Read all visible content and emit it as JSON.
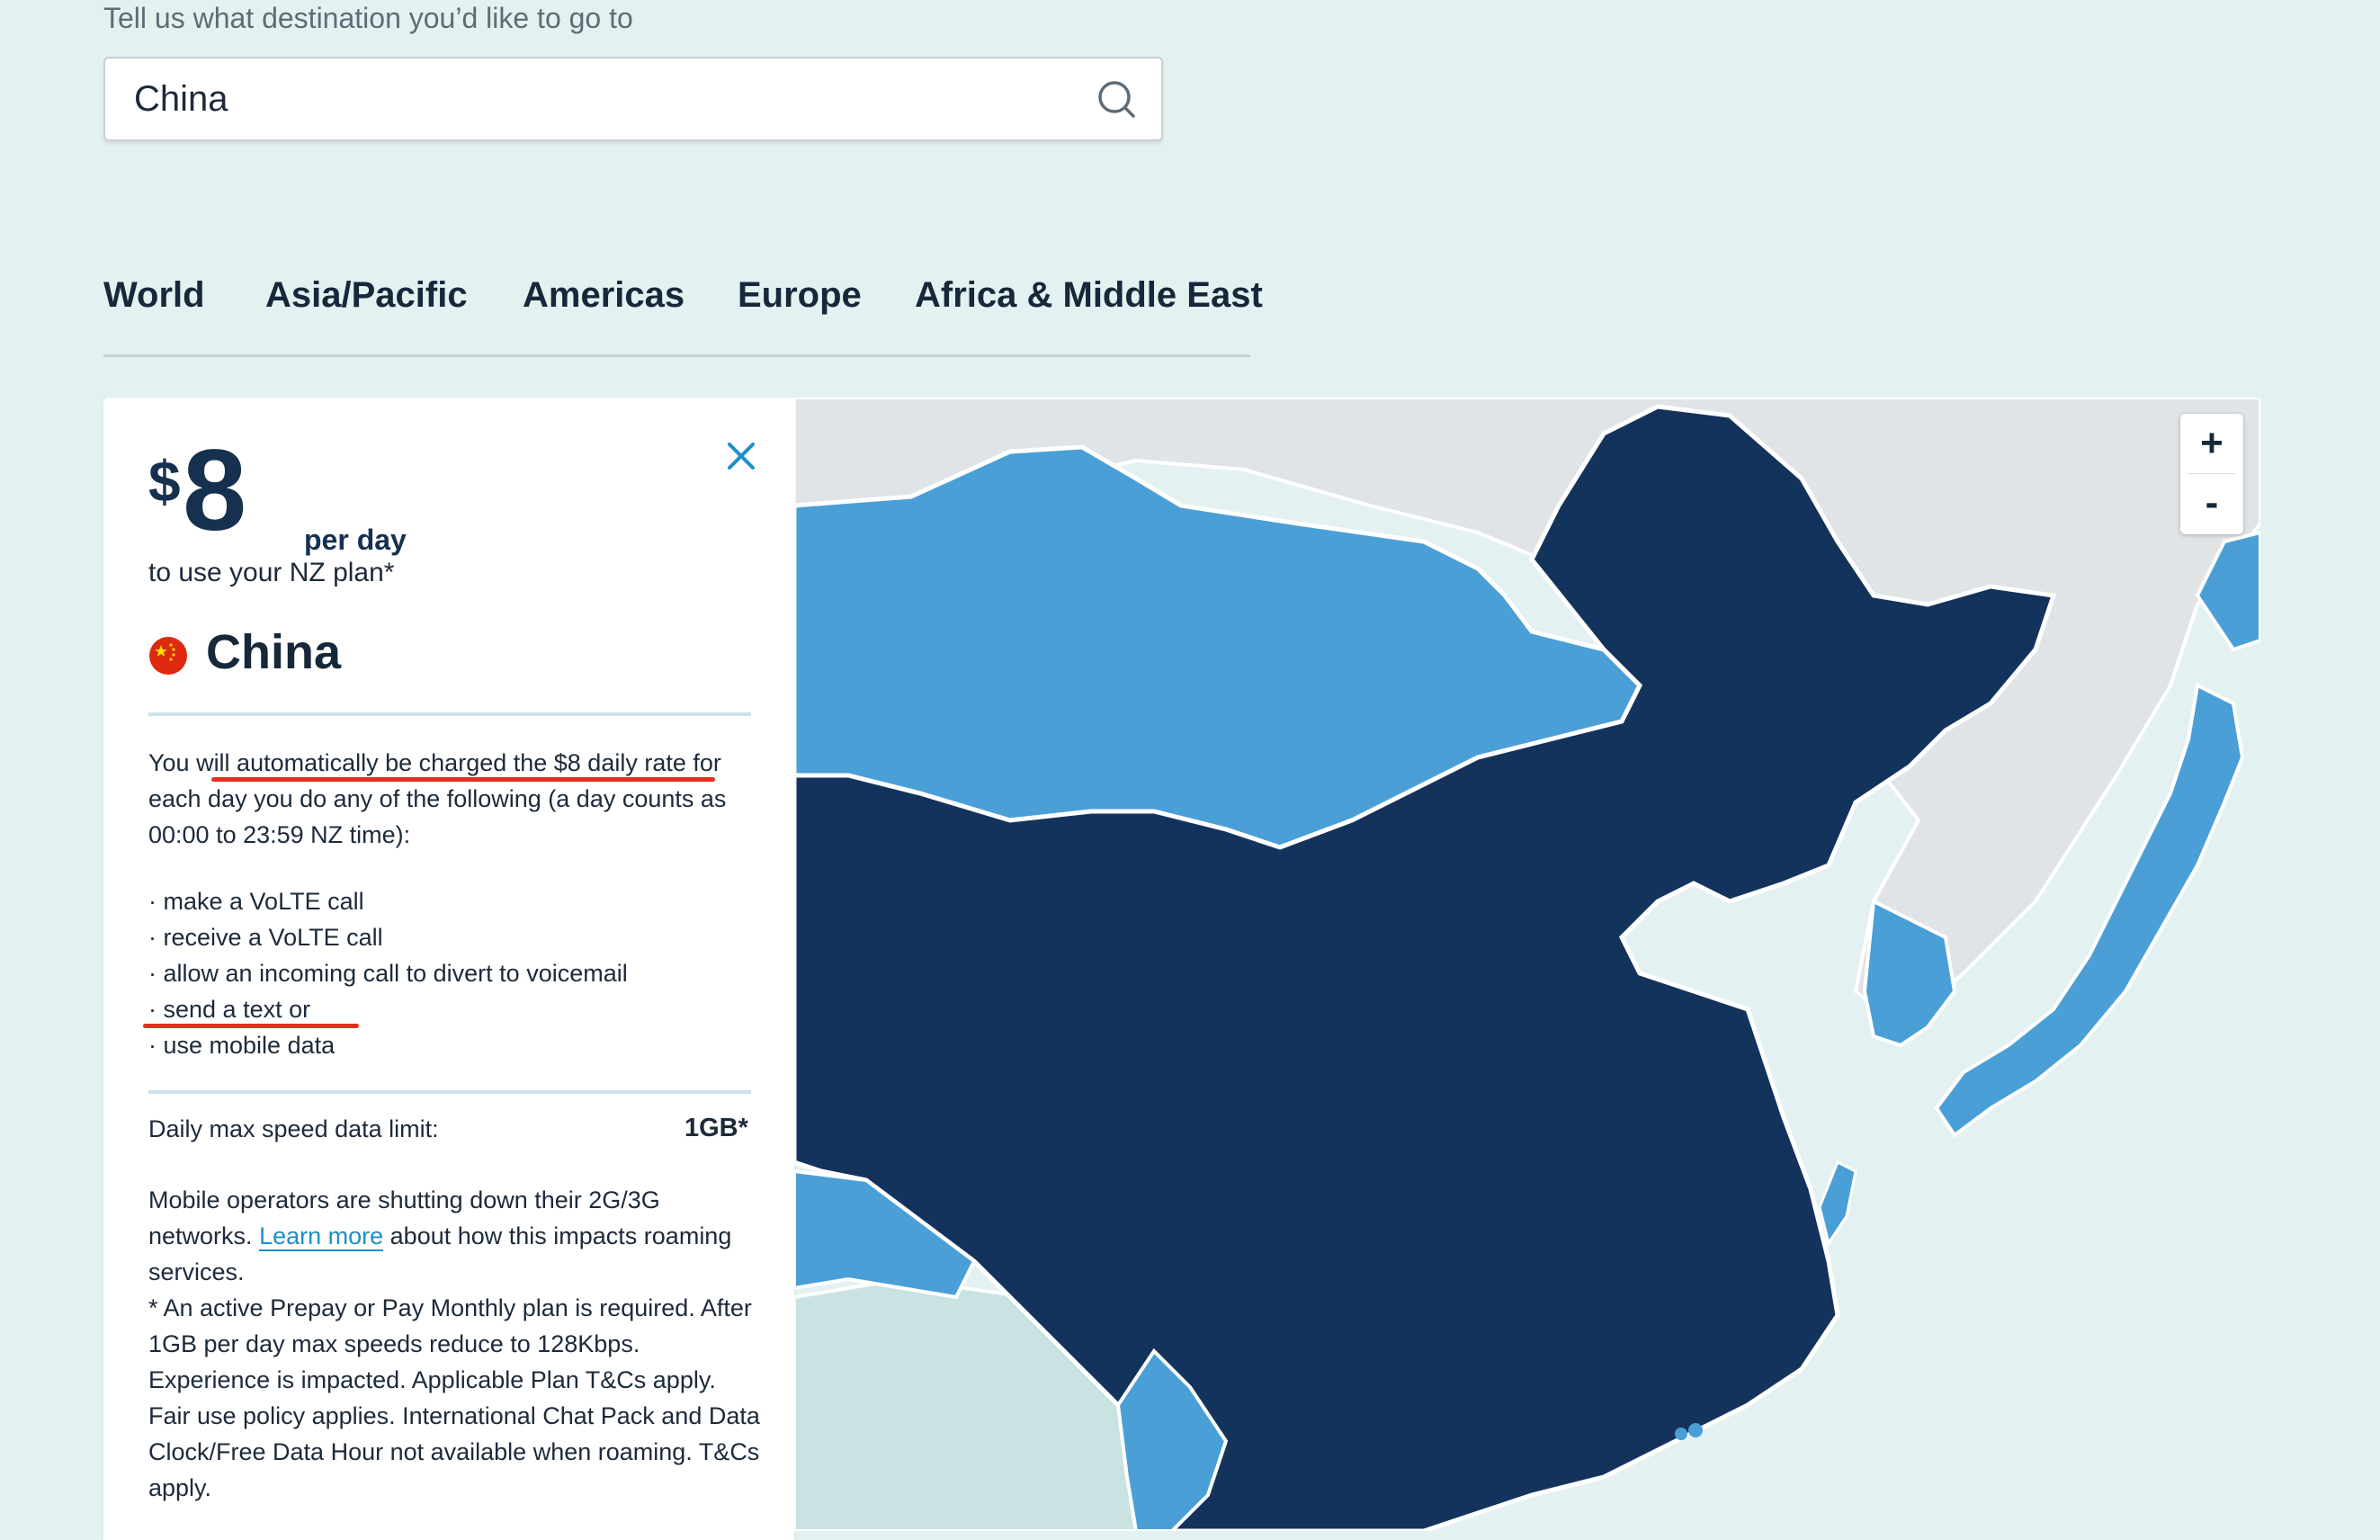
{
  "search": {
    "label": "Tell us what destination you’d like to go to",
    "value": "China",
    "placeholder": ""
  },
  "tabs": [
    {
      "label": "World"
    },
    {
      "label": "Asia/Pacific"
    },
    {
      "label": "Americas"
    },
    {
      "label": "Europe"
    },
    {
      "label": "Africa & Middle East"
    }
  ],
  "panel": {
    "price_symbol": "$",
    "price_amount": "8",
    "price_unit": "per day",
    "plan_subtitle": "to use your NZ plan*",
    "country": "China",
    "flag_icon": "china-flag-icon",
    "charge_text": "You will automatically be charged the $8 daily rate for each day you do any of the following (a day counts as 00:00 to 23:59 NZ time):",
    "bullets": [
      "make a VoLTE call",
      "receive a VoLTE call",
      "allow an incoming call to divert to voicemail",
      "send a text or",
      "use mobile data"
    ],
    "limit_label": "Daily max speed data limit:",
    "limit_value": "1GB*",
    "note_before_link": "Mobile operators are shutting down their 2G/3G networks.",
    "learn_more": "Learn more",
    "note_after_link": "about how this impacts roaming services.",
    "terms": "* An active Prepay or Pay Monthly plan is required. After 1GB per day max speeds reduce to 128Kbps. Experience is impacted. Applicable Plan T&Cs apply. Fair use policy applies. International Chat Pack and Data Clock/Free Data Hour not available when roaming. T&Cs apply."
  },
  "map": {
    "zoom_in": "+",
    "zoom_out": "-",
    "colors": {
      "selected": "#14335c",
      "available": "#4a9fd6",
      "unavailable": "#e0e4e6",
      "water": "#e4f1f2",
      "land_light": "#c9e3e2"
    }
  },
  "colors": {
    "page_bg": "#e3f1f1",
    "link": "#1e8fc6",
    "annotation": "#e2301f"
  }
}
